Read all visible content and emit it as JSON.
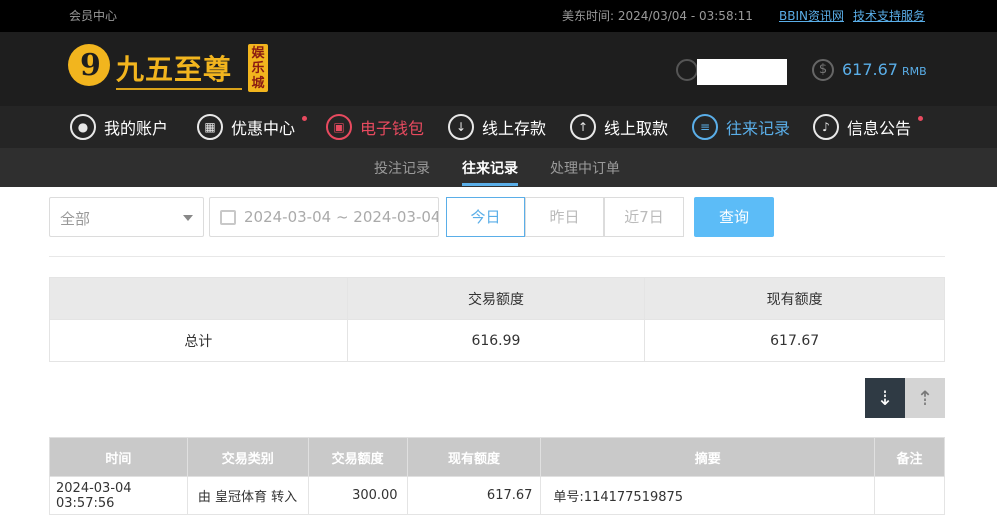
{
  "topbar": {
    "member_center": "会员中心",
    "time_label": "美东时间:",
    "time_value": "2024/03/04 - 03:58:11",
    "link_bbin": "BBIN资讯网",
    "link_support": "技术支持服务"
  },
  "header": {
    "logo_digit": "9",
    "logo_text": "九五至尊",
    "logo_badge": "娱乐城",
    "balance_value": "617.67",
    "balance_unit": "RMB",
    "money_symbol": "$"
  },
  "nav": {
    "items": [
      {
        "label": "我的账户",
        "icon": "user-icon"
      },
      {
        "label": "优惠中心",
        "icon": "gift-icon"
      },
      {
        "label": "电子钱包",
        "icon": "wallet-icon"
      },
      {
        "label": "线上存款",
        "icon": "deposit-icon"
      },
      {
        "label": "线上取款",
        "icon": "withdraw-icon"
      },
      {
        "label": "往来记录",
        "icon": "record-icon"
      },
      {
        "label": "信息公告",
        "icon": "bell-icon"
      }
    ]
  },
  "subnav": {
    "items": [
      "投注记录",
      "往来记录",
      "处理中订单"
    ]
  },
  "filter": {
    "select_value": "全部",
    "date_range": "2024-03-04 ~ 2024-03-04",
    "today": "今日",
    "yesterday": "昨日",
    "last7": "近7日",
    "query": "查询"
  },
  "summary": {
    "headers": [
      "",
      "交易额度",
      "现有额度"
    ],
    "row": [
      "总计",
      "616.99",
      "617.67"
    ]
  },
  "records": {
    "headers": [
      "时间",
      "交易类别",
      "交易额度",
      "现有额度",
      "摘要",
      "备注"
    ],
    "rows": [
      [
        "2024-03-04 03:57:56",
        "由 皇冠体育 转入",
        "300.00",
        "617.67",
        "单号:114177519875",
        ""
      ]
    ]
  },
  "colors": {
    "accent_blue": "#5aaee8",
    "accent_red": "#e84a5f",
    "logo_gold": "#f2b51e"
  }
}
